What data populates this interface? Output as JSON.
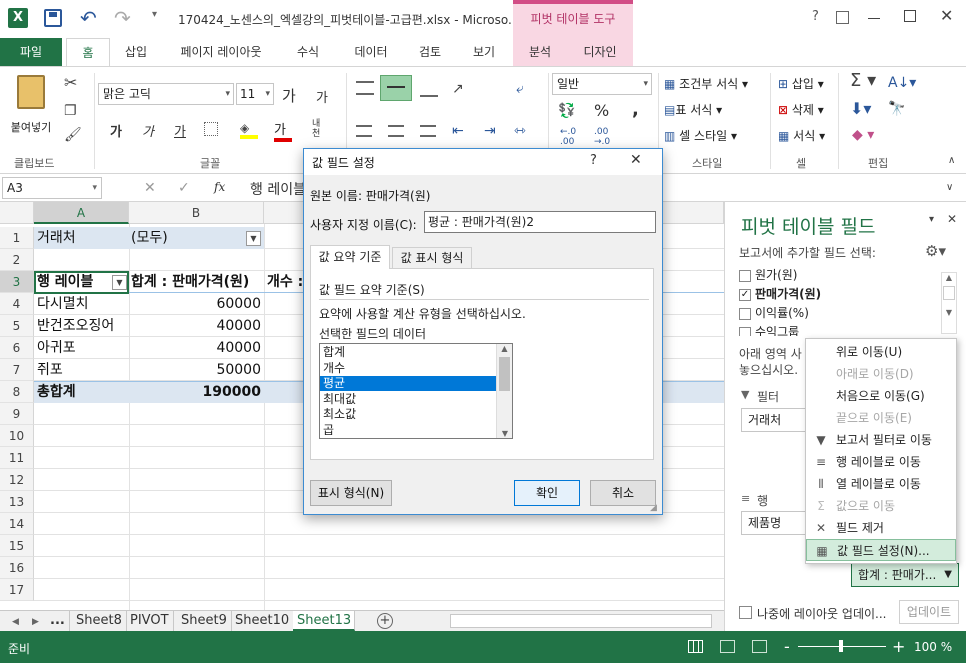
{
  "title": {
    "filename": "170424_노센스의_엑셀강의_피벗테이블-고급편.xlsx - Microso...",
    "pivot_tools": "피벗 테이블 도구",
    "help": "?"
  },
  "tabs": [
    "파일",
    "홈",
    "삽입",
    "페이지 레이아웃",
    "수식",
    "데이터",
    "검토",
    "보기",
    "분석",
    "디자인"
  ],
  "ribbon": {
    "clipboard": {
      "paste": "붙여넣기",
      "group": "클립보드"
    },
    "font": {
      "name": "맑은 고딕",
      "size": "11",
      "group": "글꼴",
      "bold": "가",
      "italic": "가",
      "underline": "가",
      "grow": "가",
      "shrink": "가",
      "color": "가",
      "phonetic": "내천"
    },
    "align": {
      "group": ""
    },
    "number": {
      "format": "일반",
      "pct": "%",
      "comma": ",",
      "inc": "←.0\n.00",
      "dec": ".00\n→.0"
    },
    "styles": {
      "cond": "조건부 서식",
      "table": "표 서식",
      "cell": "셀 스타일",
      "group": "스타일"
    },
    "cells": {
      "insert": "삽입",
      "delete": "삭제",
      "format": "서식",
      "group": "셀"
    },
    "editing": {
      "group": "편집"
    }
  },
  "formula": {
    "namebox": "A3",
    "fx": "fx",
    "content": "행 레이블"
  },
  "columns": [
    "A",
    "B"
  ],
  "rows": [
    "1",
    "2",
    "3",
    "4",
    "5",
    "6",
    "7",
    "8",
    "9",
    "10",
    "11",
    "12",
    "13",
    "14",
    "15",
    "16",
    "17"
  ],
  "cells": {
    "r1a": "거래처",
    "r1b": "(모두)",
    "r3a": "행 레이블",
    "r3b": "합계 : 판매가격(원)",
    "r3c": "개수 :",
    "r4a": "다시멸치",
    "r4b": "60000",
    "r5a": "반건조오징어",
    "r5b": "40000",
    "r6a": "아귀포",
    "r6b": "40000",
    "r7a": "쥐포",
    "r7b": "50000",
    "r8a": "총합계",
    "r8b": "190000"
  },
  "sheettabs": [
    "...",
    "Sheet8",
    "PIVOT",
    "Sheet9",
    "Sheet10",
    "Sheet13"
  ],
  "status": {
    "ready": "준비",
    "zoom": "100 %",
    "minus": "-",
    "plus": "+"
  },
  "pane": {
    "title": "피벗 테이블 필드",
    "subtitle": "보고서에 추가할 필드 선택:",
    "fields": [
      {
        "label": "원가(원)",
        "checked": false
      },
      {
        "label": "판매가격(원)",
        "checked": true
      },
      {
        "label": "이익률(%)",
        "checked": false
      },
      {
        "label": "수익그룹",
        "checked": false
      }
    ],
    "areas_text1": "아래 영역 사",
    "areas_text2": "놓으십시오.",
    "filter_label": "필터",
    "filter_item": "거래처",
    "rows_label": "행",
    "rows_item": "제품명",
    "value_item": "합계 : 판매가...",
    "defer": "나중에 레이아웃 업데이...",
    "update": "업데이트"
  },
  "context_menu": [
    {
      "label": "위로 이동(U)",
      "disabled": false,
      "icon": ""
    },
    {
      "label": "아래로 이동(D)",
      "disabled": true,
      "icon": ""
    },
    {
      "label": "처음으로 이동(G)",
      "disabled": false,
      "icon": ""
    },
    {
      "label": "끝으로 이동(E)",
      "disabled": true,
      "icon": ""
    },
    {
      "label": "보고서 필터로 이동",
      "disabled": false,
      "icon": "filter-icon"
    },
    {
      "label": "행 레이블로 이동",
      "disabled": false,
      "icon": "rows-icon"
    },
    {
      "label": "열 레이블로 이동",
      "disabled": false,
      "icon": "columns-icon"
    },
    {
      "label": "값으로 이동",
      "disabled": true,
      "icon": "sigma-icon"
    },
    {
      "label": "필드 제거",
      "disabled": false,
      "icon": "x-icon"
    },
    {
      "label": "값 필드 설정(N)...",
      "disabled": false,
      "icon": "settings-icon"
    }
  ],
  "dialog": {
    "title": "값 필드 설정",
    "source_label": "원본 이름:",
    "source_value": "판매가격(원)",
    "custom_label": "사용자 지정 이름(C):",
    "custom_value": "평균 : 판매가격(원)2",
    "tab1": "값 요약 기준",
    "tab2": "값 표시 형식",
    "section": "값 필드 요약 기준(S)",
    "desc1": "요약에 사용할 계산 유형을 선택하십시오.",
    "desc2": "선택한 필드의 데이터",
    "list": [
      "합계",
      "개수",
      "평균",
      "최대값",
      "최소값",
      "곱"
    ],
    "selected": "평균",
    "format_btn": "표시 형식(N)",
    "ok": "확인",
    "cancel": "취소",
    "help": "?",
    "close": "✕"
  },
  "colors": {
    "excel_green": "#217346",
    "pivot_tab": "#f9d7e3",
    "selected": "#0078d7"
  }
}
